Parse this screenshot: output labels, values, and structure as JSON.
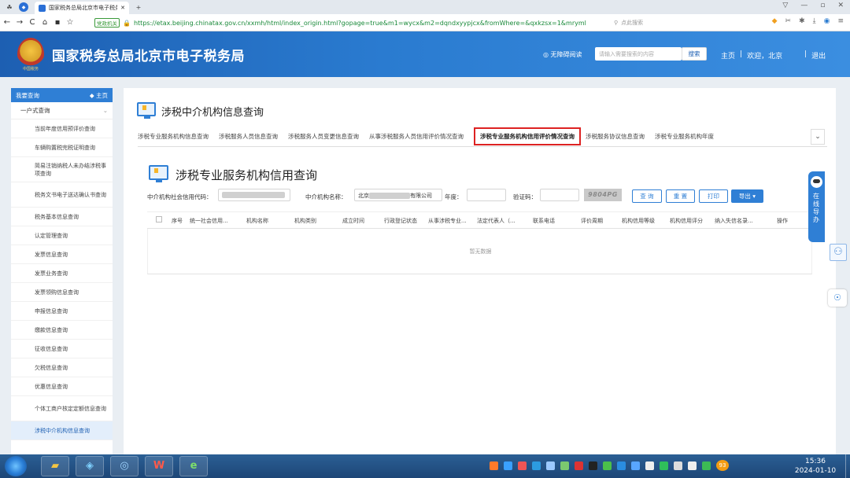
{
  "browser": {
    "tab_title": "国家税务总局北京市电子税务",
    "url_badge": "党政机关",
    "url": "https://etax.beijing.chinatax.gov.cn/xxmh/html/index_origin.html?gopage=true&m1=wycx&m2=dqndxyypjcx&fromWhere=&qxkzsx=1&mryml",
    "search_placeholder": "点此搜索",
    "icons": [
      "back-icon",
      "forward-icon",
      "refresh-icon",
      "home-icon",
      "lock-icon",
      "star-icon",
      "download-icon",
      "menu-icon"
    ]
  },
  "header": {
    "emblem_text": "中国税务",
    "site_title": "国家税务总局北京市电子税务局",
    "accessibility": "◎ 无障碍阅读",
    "search_placeholder": "请输入需要搜索的内容",
    "search_button": "搜索",
    "links": [
      "主页",
      "|",
      "欢迎，北京",
      "|",
      "退出"
    ]
  },
  "sidebar": {
    "header": "我要查询",
    "home_link": "◆ 主页",
    "group": "一户式查询",
    "items": [
      {
        "label": "当前年度信用预评价查询"
      },
      {
        "label": "车辆购置税完税证明查询"
      },
      {
        "label": "简易注销纳税人未办结涉税事项查询"
      },
      {
        "label": "税务文书电子送达确认书查询"
      },
      {
        "label": "税务基本信息查询"
      },
      {
        "label": "认定管理查询"
      },
      {
        "label": "发票信息查询"
      },
      {
        "label": "发票业务查询"
      },
      {
        "label": "发票领购信息查询"
      },
      {
        "label": "申报信息查询"
      },
      {
        "label": "缴款信息查询"
      },
      {
        "label": "征收信息查询"
      },
      {
        "label": "欠税信息查询"
      },
      {
        "label": "优惠信息查询"
      },
      {
        "label": "个体工商户核定定额信息查询"
      },
      {
        "label": "涉税中介机构信息查询"
      }
    ]
  },
  "main": {
    "page_title": "涉税中介机构信息查询",
    "tabs": [
      {
        "label": "涉税专业服务机构信息查询",
        "selected": false
      },
      {
        "label": "涉税服务人员信息查询",
        "selected": false
      },
      {
        "label": "涉税服务人员变更信息查询",
        "selected": false
      },
      {
        "label": "从事涉税服务人员信用评价情况查询",
        "selected": false
      },
      {
        "label": "涉税专业服务机构信用评价情况查询",
        "selected": true
      },
      {
        "label": "涉税服务协议信息查询",
        "selected": false
      },
      {
        "label": "涉税专业服务机构年度",
        "selected": false
      }
    ],
    "section_title": "涉税专业服务机构信用查询",
    "form": {
      "credit_code_label": "中介机构社会信用代码：",
      "name_label": "中介机构名称：",
      "name_prefix": "北京",
      "name_suffix": "有限公司",
      "year_label": "年度：",
      "captcha_label": "验证码：",
      "captcha_text": "9804PG"
    },
    "buttons": {
      "query": "查 询",
      "reset": "重 置",
      "print": "打印",
      "export": "导出 ▾"
    },
    "table": {
      "columns": [
        "序号",
        "统一社会信用...",
        "机构名称",
        "机构类别",
        "成立时间",
        "行政登记状态",
        "从事涉税专业...",
        "法定代表人（...",
        "联系电话",
        "评价周期",
        "机构信用等级",
        "机构信用评分",
        "纳入失信名录...",
        "操作"
      ],
      "empty_text": "暂无数据"
    }
  },
  "widgets": {
    "online_service": "在线导办"
  },
  "taskbar": {
    "time": "15:36",
    "date": "2024-01-10",
    "badge": "93"
  }
}
